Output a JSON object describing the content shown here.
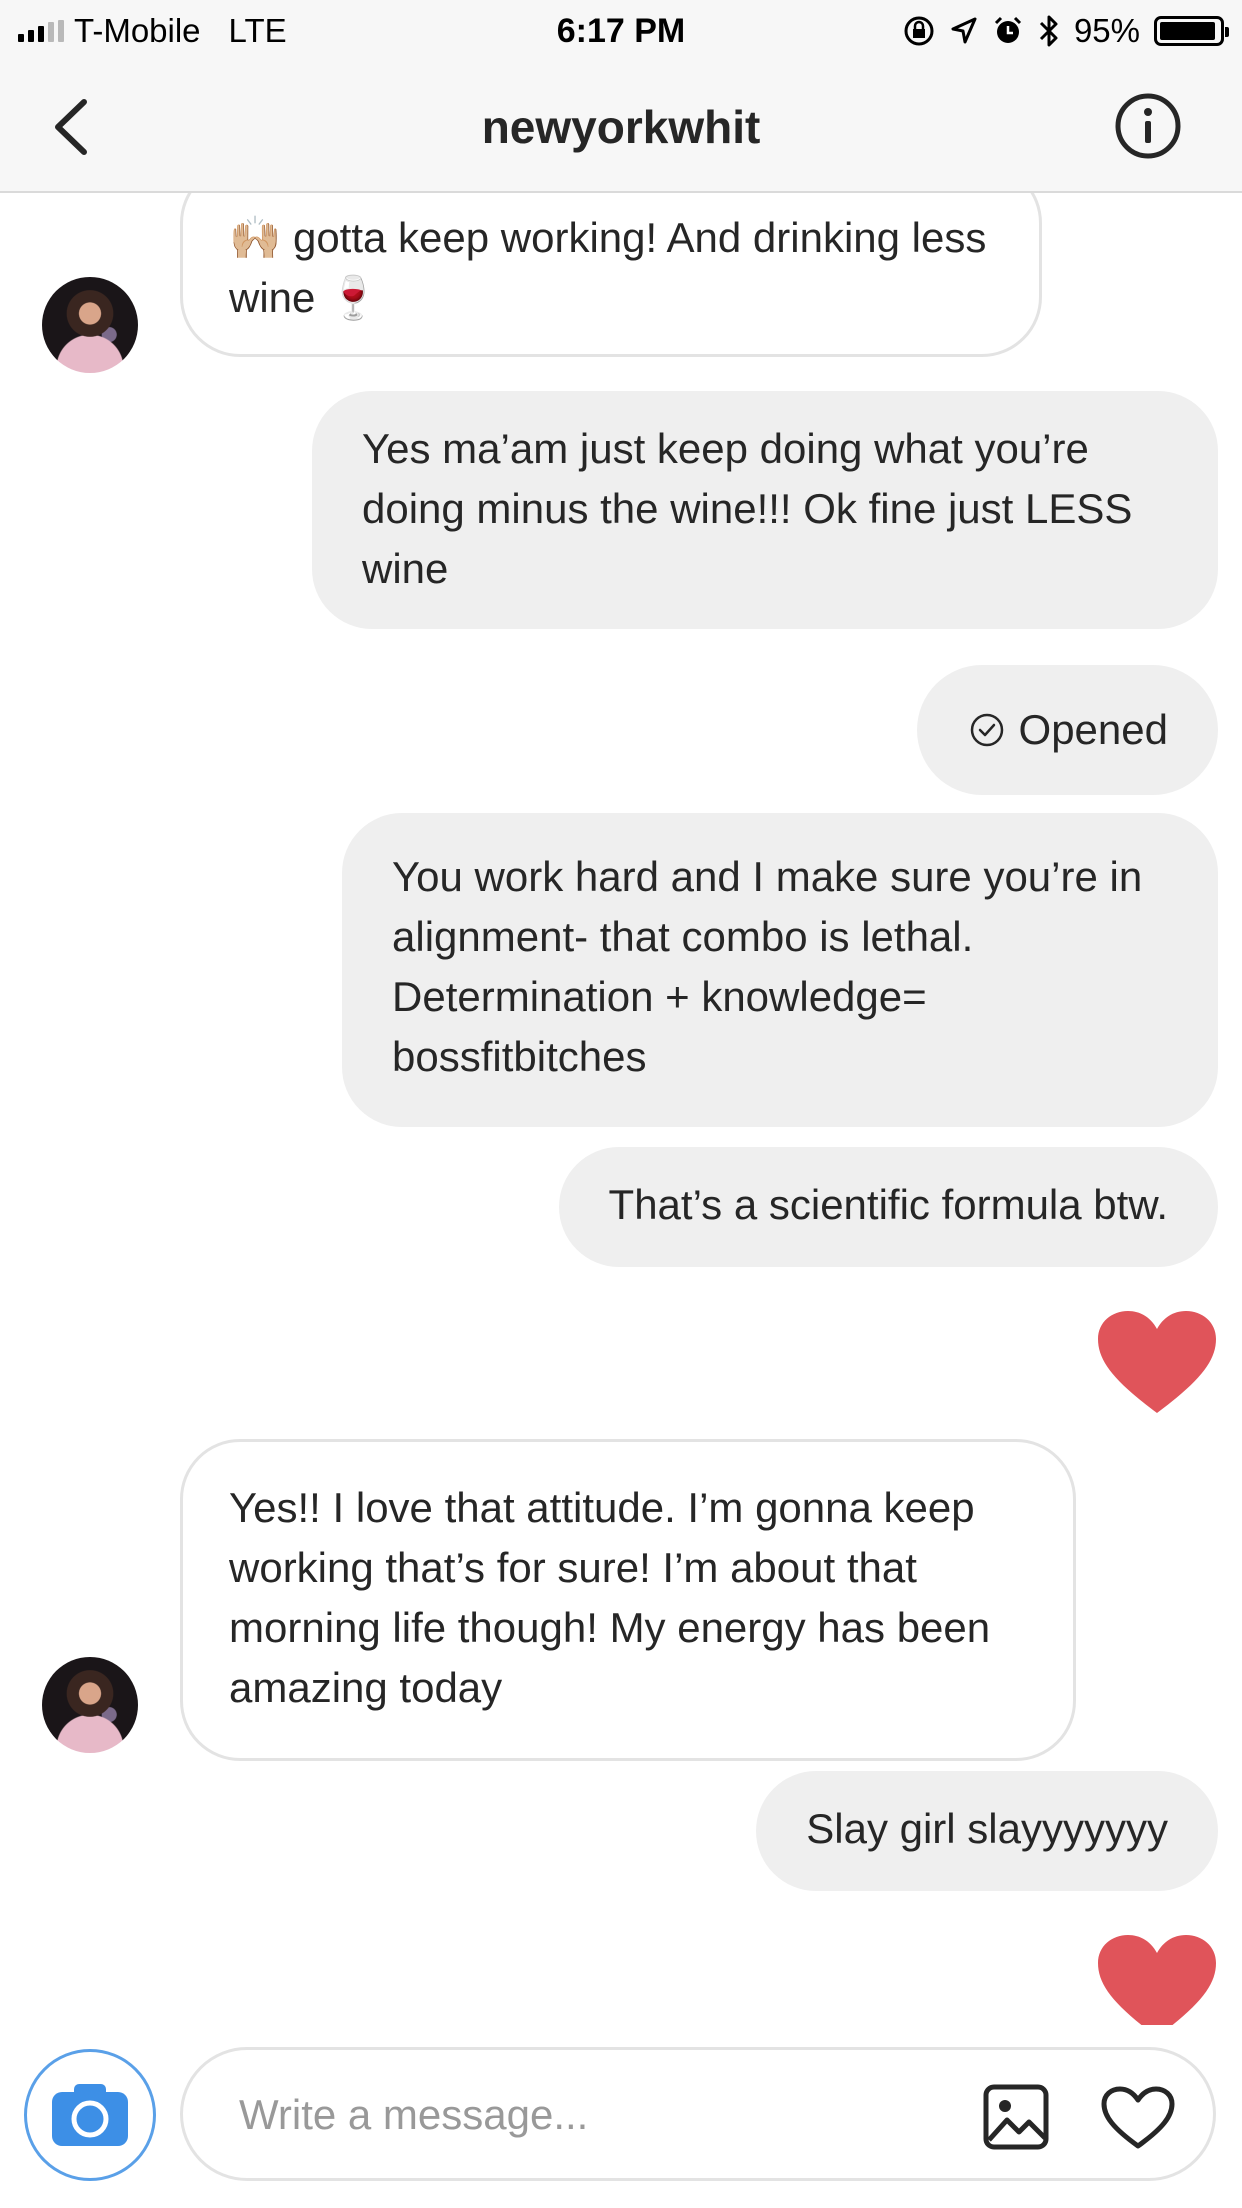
{
  "status_bar": {
    "carrier": "T-Mobile",
    "network": "LTE",
    "time": "6:17 PM",
    "battery": "95%",
    "icons": [
      "signal-icon",
      "orientation-lock-icon",
      "location-icon",
      "alarm-icon",
      "bluetooth-icon",
      "battery-icon"
    ]
  },
  "header": {
    "title": "newyorkwhit",
    "back_icon": "chevron-left-icon",
    "info_icon": "info-icon"
  },
  "messages": [
    {
      "direction": "incoming",
      "text": "🙌🏼 gotta keep working! And drinking less wine 🍷"
    },
    {
      "direction": "outgoing",
      "text": "Yes ma’am just keep doing what you’re doing minus the wine!!! Ok fine just LESS wine"
    },
    {
      "direction": "status",
      "text": "Opened"
    },
    {
      "direction": "outgoing",
      "text": "You work hard and I make sure you’re in alignment- that combo is lethal. Determination + knowledge= bossfitbitches"
    },
    {
      "direction": "outgoing",
      "text": "That’s a scientific formula btw."
    },
    {
      "direction": "outgoing",
      "type": "heart",
      "icon": "heart-icon"
    },
    {
      "direction": "incoming",
      "text": "Yes!! I love that attitude. I’m gonna keep working that’s for sure! I’m about that morning life though! My energy has been amazing today"
    },
    {
      "direction": "outgoing",
      "text": "Slay girl slayyyyyyy"
    },
    {
      "direction": "outgoing",
      "type": "heart",
      "icon": "heart-icon"
    }
  ],
  "composer": {
    "placeholder": "Write a message...",
    "camera_icon": "camera-icon",
    "gallery_icon": "gallery-icon",
    "like_icon": "heart-outline-icon"
  },
  "colors": {
    "accent_blue": "#3897f0",
    "heart_red": "#e0545a",
    "outgoing_bubble": "#efefef",
    "bar_bg": "#f7f7f7"
  }
}
